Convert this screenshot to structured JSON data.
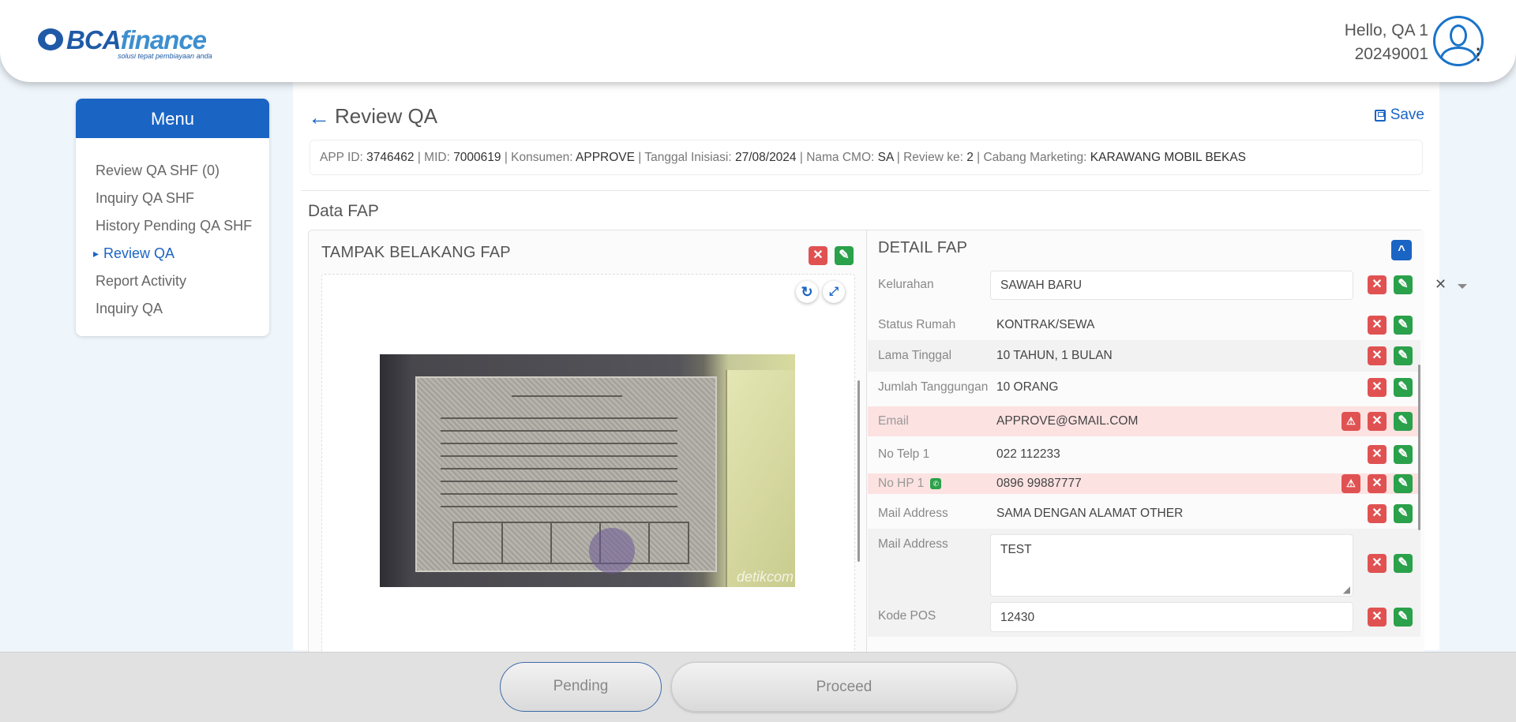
{
  "header": {
    "logo_main": "BCA",
    "logo_accent": "finance",
    "logo_tagline": "solusi tepat pembiayaan anda",
    "greeting": "Hello, QA 1",
    "user_id": "20249001"
  },
  "menu": {
    "title": "Menu",
    "items": [
      {
        "label": "Review QA SHF (0)"
      },
      {
        "label": "Inquiry QA SHF"
      },
      {
        "label": "History Pending QA SHF"
      },
      {
        "label": "Review QA"
      },
      {
        "label": "Report Activity"
      },
      {
        "label": "Inquiry QA"
      }
    ],
    "active_item": "Review QA"
  },
  "page": {
    "title": "Review QA",
    "save_label": "Save",
    "info": {
      "app_id_label": "APP ID:",
      "app_id": "3746462",
      "mid_label": "MID:",
      "mid": "7000619",
      "konsumen_label": "Konsumen:",
      "konsumen": "APPROVE",
      "tanggal_label": "Tanggal Inisiasi:",
      "tanggal": "27/08/2024",
      "cmo_label": "Nama CMO:",
      "cmo": "SA",
      "review_label": "Review ke:",
      "review": "2",
      "cabang_label": "Cabang Marketing:",
      "cabang": "KARAWANG MOBIL BEKAS"
    },
    "section_title": "Data FAP"
  },
  "left_pane": {
    "title": "TAMPAK BELAKANG FAP",
    "watermark": "detikcom"
  },
  "detail": {
    "title": "DETAIL FAP",
    "fields": [
      {
        "label": "Kelurahan",
        "value": "SAWAH BARU"
      },
      {
        "label": "Status Rumah",
        "value": "KONTRAK/SEWA"
      },
      {
        "label": "Lama Tinggal",
        "value": "10 TAHUN, 1 BULAN"
      },
      {
        "label": "Jumlah Tanggungan",
        "value": "10 ORANG"
      },
      {
        "label": "Email",
        "value": "APPROVE@GMAIL.COM"
      },
      {
        "label": "No Telp 1",
        "value": "022 112233"
      },
      {
        "label": "No HP 1",
        "value": "0896 99887777"
      },
      {
        "label": "Mail Address",
        "value": "SAMA DENGAN ALAMAT OTHER"
      },
      {
        "label": "Mail Address",
        "value": "TEST"
      },
      {
        "label": "Kode POS",
        "value": "12430"
      }
    ]
  },
  "footer": {
    "pending_label": "Pending",
    "proceed_label": "Proceed"
  },
  "colors": {
    "brand_blue": "#1a64c4",
    "reject_red": "#e05252",
    "approve_green": "#2aa14a",
    "error_row": "#fde2e2"
  },
  "icons": {
    "back": "arrow-left-icon",
    "save": "floppy-disk-icon",
    "reject": "x-icon",
    "approve": "pencil-icon",
    "warning": "warning-triangle-icon",
    "rotate": "rotate-icon",
    "fullscreen": "expand-icon",
    "whatsapp": "whatsapp-icon",
    "collapse": "chevron-up-icon"
  }
}
